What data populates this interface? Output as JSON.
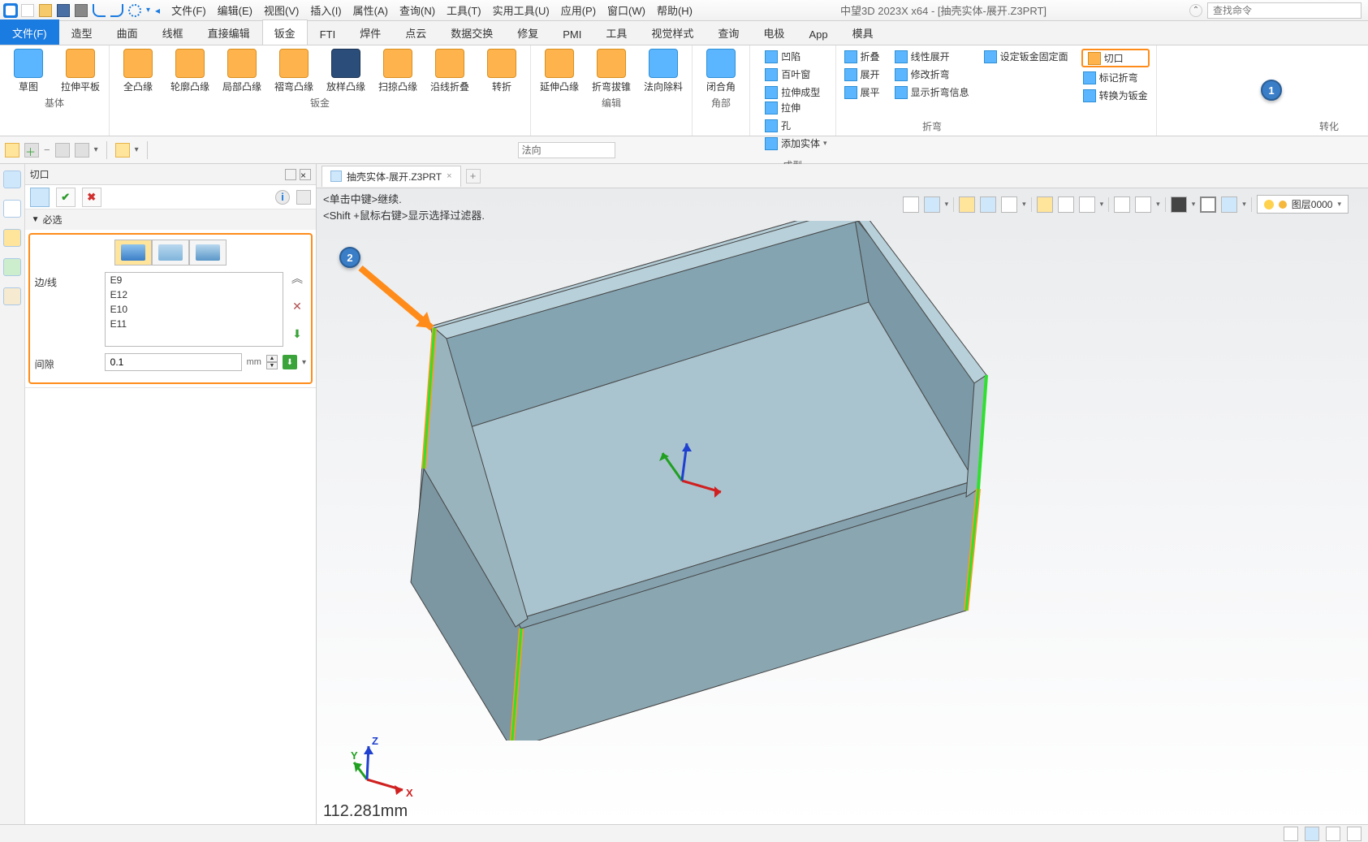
{
  "app_title": "中望3D 2023X x64 - [抽壳实体-展开.Z3PRT]",
  "search_placeholder": "查找命令",
  "menus": [
    "文件(F)",
    "编辑(E)",
    "视图(V)",
    "插入(I)",
    "属性(A)",
    "查询(N)",
    "工具(T)",
    "实用工具(U)",
    "应用(P)",
    "窗口(W)",
    "帮助(H)"
  ],
  "ribbon_tabs": [
    "文件(F)",
    "造型",
    "曲面",
    "线框",
    "直接编辑",
    "钣金",
    "FTI",
    "焊件",
    "点云",
    "数据交换",
    "修复",
    "PMI",
    "工具",
    "视觉样式",
    "查询",
    "电极",
    "App",
    "模具"
  ],
  "ribbon_active": 5,
  "ribbon": {
    "g1": {
      "items": [
        "草图",
        "拉伸平板"
      ],
      "caption": "基体"
    },
    "g2": {
      "items": [
        "全凸缘",
        "轮廓凸缘",
        "局部凸缘",
        "褶弯凸缘",
        "放样凸缘",
        "扫掠凸缘",
        "沿线折叠",
        "转折"
      ],
      "caption": "钣金"
    },
    "g3": {
      "items": [
        "延伸凸缘",
        "折弯拔锥",
        "法向除料"
      ],
      "caption": "编辑"
    },
    "g4": {
      "items": [
        "闭合角"
      ],
      "caption": "角部"
    },
    "g5": {
      "rowA": [
        "凹陷",
        "拉伸"
      ],
      "rowB": [
        "百叶窗",
        "孔"
      ],
      "rowC": [
        "拉伸成型",
        "添加实体"
      ],
      "caption": "成型"
    },
    "g6": {
      "rowA": [
        "折叠",
        "线性展开",
        "设定钣金固定面",
        "切口"
      ],
      "rowB": [
        "展开",
        "修改折弯",
        "",
        "标记折弯"
      ],
      "rowC": [
        "展平",
        "显示折弯信息",
        "",
        "转换为钣金"
      ],
      "caption": "折弯",
      "caption2": "转化"
    }
  },
  "sub_direction": "法向",
  "panel": {
    "title": "切口",
    "section": "必选",
    "edgelabel": "边/线",
    "edges": [
      "E9",
      "E12",
      "E10",
      "E11"
    ],
    "gaplabel": "间隙",
    "gapvalue": "0.1",
    "gapunit": "mm"
  },
  "doc_tab": "抽壳实体-展开.Z3PRT",
  "hint1": "<单击中键>继续.",
  "hint2": "<Shift +鼠标右键>显示选择过滤器.",
  "layer": "图层0000",
  "coord": "112.281mm",
  "callouts": {
    "one": "1",
    "two": "2"
  }
}
